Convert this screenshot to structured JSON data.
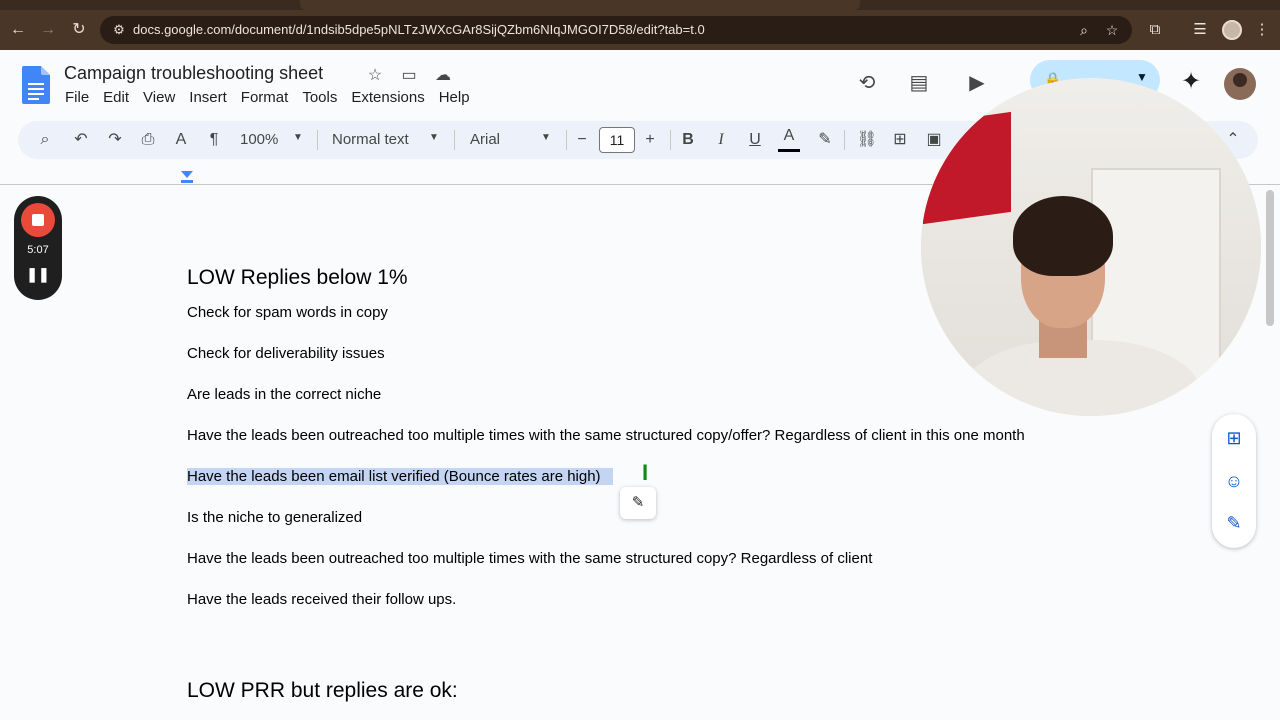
{
  "browser": {
    "url": "docs.google.com/document/d/1ndsib5dpe5pNLTzJWXcGAr8SijQZbm6NIqJMGOI7D58/edit?tab=t.0"
  },
  "document": {
    "title": "Campaign troubleshooting sheet"
  },
  "menu": [
    "File",
    "Edit",
    "View",
    "Insert",
    "Format",
    "Tools",
    "Extensions",
    "Help"
  ],
  "toolbar": {
    "zoom": "100%",
    "style": "Normal text",
    "font": "Arial",
    "font_size": "11"
  },
  "recording": {
    "elapsed": "5:07"
  },
  "content": {
    "section1_heading": "LOW Replies below 1%",
    "items": [
      "Check for spam words in copy",
      "Check for deliverability issues",
      "Are leads in the correct niche",
      "Have the leads been outreached too multiple times with the same structured copy/offer? Regardless of client in this one month",
      "Have the leads been email list verified (Bounce rates are high)",
      "Is the niche to generalized",
      "Have the leads been outreached too multiple times with the same structured copy? Regardless of client",
      "Have the leads received their follow ups."
    ],
    "section2_heading": "LOW PRR but replies are ok:"
  },
  "colors": {
    "selection": "#c3d5f3",
    "share_button": "#c2e7ff",
    "record_stop": "#ea4a3a",
    "accent_blue": "#0b57d0"
  }
}
